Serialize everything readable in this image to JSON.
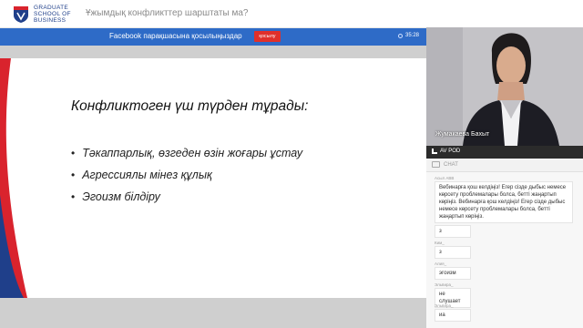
{
  "header": {
    "logo_lines": [
      "GRADUATE",
      "SCHOOL OF",
      "BUSINESS"
    ],
    "page_title": "Ұжымдық конфликттер шарштаты ма?"
  },
  "banner": {
    "text": "Facebook парақшасына қосылыңыздар",
    "button_label": "қосылу",
    "timer": "35:28"
  },
  "slide": {
    "title": "Конфликтоген үш түрден тұрады:",
    "bullets": [
      "Тәкаппарлық, өзгеден өзін жоғары ұстау",
      "Агрессиялы мінез құлық",
      "Эгоизм білдіру"
    ]
  },
  "video": {
    "presenter_name": "Жумакаева Бахыт",
    "bar_label": "AV POD"
  },
  "chat": {
    "header_label": "CHAT",
    "messages": [
      {
        "sender": "Асыл АВВ",
        "text": "Вебинарға қош келдіңіз! Егер сізде дыбыс немесе көрсету проблемалары болса, бетті жаңартып көріңіз. Вебинарға қош келдіңіз! Егер сізде дыбыс немесе көрсету проблемалары болса, бетті жаңартып көріңіз."
      },
      {
        "sender": "",
        "text": "з"
      },
      {
        "sender": "Ким_",
        "text": "з"
      },
      {
        "sender": "Алия_",
        "text": "эгоизм"
      },
      {
        "sender": "Эльвира_",
        "text": "не слушает"
      },
      {
        "sender": "Эльвира_",
        "text": "иа"
      }
    ]
  },
  "colors": {
    "banner_blue": "#2e6bc7",
    "join_red": "#e0302b",
    "logo_navy": "#1f3f8a",
    "swoosh_red": "#d9232d"
  }
}
